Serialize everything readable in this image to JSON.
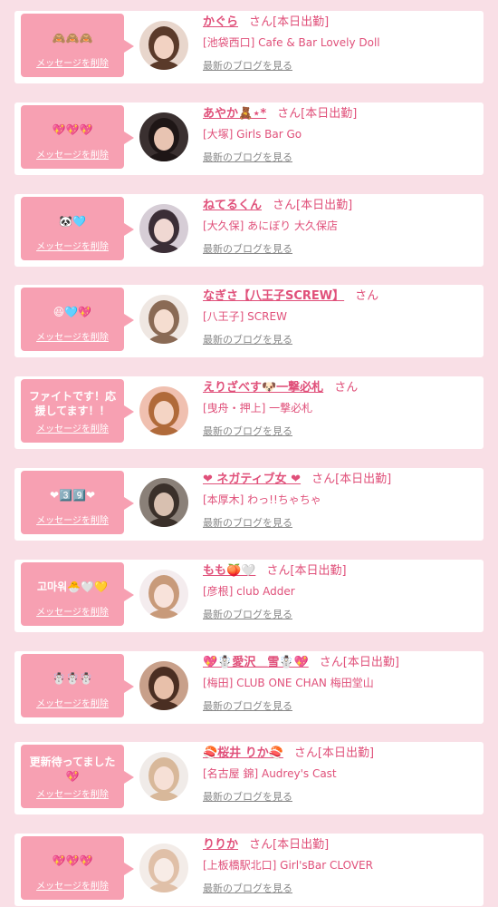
{
  "ui": {
    "delete_label": "メッセージを削除",
    "san": "さん",
    "blog_link": "最新のブログを見る"
  },
  "colors": {
    "page_bg": "#f9dfe6",
    "bubble_bg": "#f7a0b2",
    "accent": "#e0507a",
    "blog_link": "#888888"
  },
  "messages": [
    {
      "bubble_text": "🙈🙈🙈",
      "name": "かぐら",
      "status": "[本日出勤]",
      "shop": "[池袋西口] Cafe & Bar Lovely Doll",
      "avatar": {
        "bg": "#e8d6cc",
        "hair": "#5a3a2a",
        "skin": "#f2d2c2"
      }
    },
    {
      "bubble_text": "💖💖💖",
      "name": "あやか🧸⋆*",
      "status": "[本日出勤]",
      "shop": "[大塚] Girls Bar Go",
      "avatar": {
        "bg": "#3a3030",
        "hair": "#1e1616",
        "skin": "#e8c4b2"
      }
    },
    {
      "bubble_text": "🐼🩵",
      "name": "ねてるくん",
      "status": "[本日出勤]",
      "shop": "[大久保] あにぼり 大久保店",
      "avatar": {
        "bg": "#d6cdd6",
        "hair": "#3b2e36",
        "skin": "#f0d8d2"
      }
    },
    {
      "bubble_text": "😆🩵💖",
      "name": "なぎさ【八王子SCREW】",
      "status": "",
      "shop": "[八王子] SCREW",
      "avatar": {
        "bg": "#efe7e2",
        "hair": "#8a6a55",
        "skin": "#f5ddd0"
      }
    },
    {
      "bubble_text": "ファイトです！応援してます！！",
      "name": "えりざべす🐶一撃必札",
      "status": "",
      "shop": "[曳舟・押上] 一撃必札",
      "avatar": {
        "bg": "#f0c0b0",
        "hair": "#b06a3a",
        "skin": "#f4d4c4"
      }
    },
    {
      "bubble_text": "❤︎3️⃣9️⃣❤︎",
      "name": "❤ ネガティブ女 ❤",
      "status": "[本日出勤]",
      "shop": "[本厚木] わっ!!ちゃちゃ",
      "avatar": {
        "bg": "#8a8078",
        "hair": "#3a302a",
        "skin": "#d8c0b0"
      }
    },
    {
      "bubble_text": "고마워🐣🤍💛",
      "name": "もも🍑🤍",
      "status": "[本日出勤]",
      "shop": "[彦根] club Adder",
      "avatar": {
        "bg": "#f4ecee",
        "hair": "#c89a7a",
        "skin": "#f8e2da"
      }
    },
    {
      "bubble_text": "☃️☃️☃️",
      "name": "💖☃️愛沢＿雪☃️💖",
      "status": "[本日出勤]",
      "shop": "[梅田] CLUB ONE CHAN 梅田堂山",
      "avatar": {
        "bg": "#c8a08a",
        "hair": "#4a2e22",
        "skin": "#e8c0aa"
      }
    },
    {
      "bubble_text": "更新待ってました💖",
      "name": "🍣桜井 りか🍣",
      "status": "[本日出勤]",
      "shop": "[名古屋 錦] Audrey's Cast",
      "avatar": {
        "bg": "#f0ebe8",
        "hair": "#d8b89a",
        "skin": "#f6e0d6"
      }
    },
    {
      "bubble_text": "💖💖💖",
      "name": "りりか",
      "status": "[本日出勤]",
      "shop": "[上板橋駅北口] Girl'sBar CLOVER",
      "avatar": {
        "bg": "#f3ece8",
        "hair": "#e0c0a8",
        "skin": "#f8ece6"
      }
    }
  ]
}
